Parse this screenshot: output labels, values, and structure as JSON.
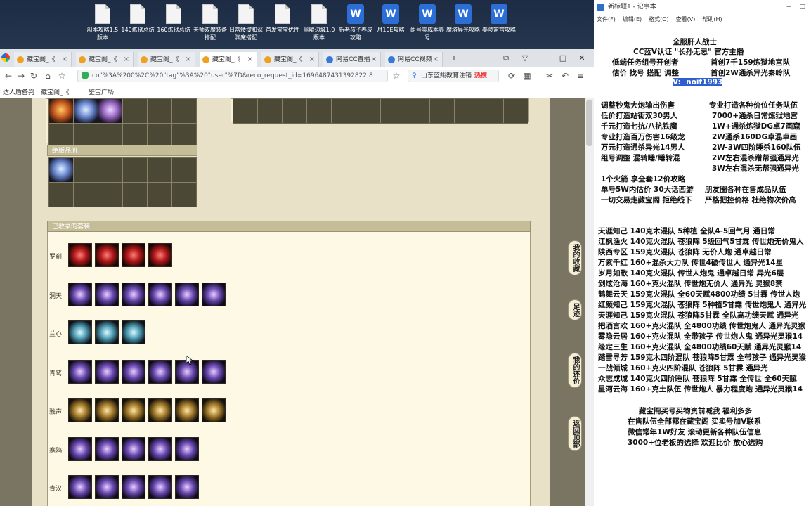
{
  "desktop": {
    "icons": [
      {
        "label": "副本攻略1.5版本",
        "type": "doc"
      },
      {
        "label": "140炼狱总结",
        "type": "doc"
      },
      {
        "label": "160炼狱总结",
        "type": "doc"
      },
      {
        "label": "天师双魔装备搭配",
        "type": "doc"
      },
      {
        "label": "日常矮拔和深渊魔搭配",
        "type": "doc"
      },
      {
        "label": "首发宝宝优性",
        "type": "doc"
      },
      {
        "label": "黑曜边城1.0版本",
        "type": "doc"
      },
      {
        "label": "新老孩子养成攻略",
        "type": "word"
      },
      {
        "label": "月10E攻略",
        "type": "word"
      },
      {
        "label": "组号零成本养号",
        "type": "word"
      },
      {
        "label": "魔塔异光攻略",
        "type": "word"
      },
      {
        "label": "秦陵宙宫攻略",
        "type": "word"
      }
    ]
  },
  "browser": {
    "tabs": [
      {
        "label": "藏宝阁_《",
        "active": false,
        "icon": "cbg"
      },
      {
        "label": "藏宝阁_《",
        "active": false,
        "icon": "cbg"
      },
      {
        "label": "藏宝阁_《",
        "active": false,
        "icon": "cbg"
      },
      {
        "label": "藏宝阁_《",
        "active": true,
        "icon": "cbg"
      },
      {
        "label": "藏宝阁_《",
        "active": false,
        "icon": "cbg"
      },
      {
        "label": "网易CC直播",
        "active": false,
        "icon": "cc"
      },
      {
        "label": "网易CC视频",
        "active": false,
        "icon": "cc"
      }
    ],
    "tab_close": "×",
    "new_tab": "+",
    "window_controls": [
      "⧉",
      "▽",
      "−",
      "□",
      "✕"
    ],
    "url": "co\"%3A%200%2C%20\"tag\"%3A%20\"user\"%7D&reco_request_id=1696487431392822|8",
    "search_text": "山东蓝翔教育注销",
    "search_hot": "热搜",
    "bookmarks": [
      "达人盾备判",
      "藏宝阁_《",
      "鉴宝广场"
    ]
  },
  "game_page": {
    "section_upper_title": "绝版品册",
    "section_sets_title": "已收录的套装",
    "sets": [
      {
        "name": "罗刹:",
        "count": 4,
        "style": "red"
      },
      {
        "name": "洞天:",
        "count": 6,
        "style": "violet"
      },
      {
        "name": "兰心:",
        "count": 3,
        "style": "cyan"
      },
      {
        "name": "青鸾:",
        "count": 6,
        "style": "violet"
      },
      {
        "name": "雅声:",
        "count": 6,
        "style": "gold"
      },
      {
        "name": "寒鸦:",
        "count": 5,
        "style": "violet"
      },
      {
        "name": "青汉:",
        "count": 5,
        "style": "violet"
      }
    ],
    "side_tabs": [
      "我的收藏",
      "足迹",
      "我的还价",
      "返回顶部"
    ]
  },
  "notepad": {
    "title": "新标题1 - 记事本",
    "menu": [
      "文件(F)",
      "编辑(E)",
      "格式(O)",
      "查看(V)",
      "帮助(H)"
    ],
    "header_lines": [
      "全服肝人战士",
      "CC蓝V认证 \"长孙无忌\" 官方主播",
      "低端任务组号开创者",
      "估价 找号 搭配 调整"
    ],
    "header_right": [
      "首创7千159炼狱地宫队",
      "首创2W通杀异光秦岭队"
    ],
    "vx_line": "V:  noif1993",
    "left_col": [
      "调整秒鬼大炮输出伤害",
      "低价打造站街双30男人",
      "千元打造七抗/八抗铁魔",
      "专业打造百万伤害16级龙",
      "万元打造通杀异光14男人",
      "组号调整 混转睡/睡转混"
    ],
    "right_col": [
      "专业打造各种价位任务队伍",
      "7000+通杀日常炼狱地宫",
      "1W+通杀炼狱DG卓7画窟",
      "2W通杀160DG卓混卓画",
      "2W-3W四阶睡杀160队伍",
      "2W左右混杀蹭帮强通异光",
      "3W左右混杀无帮强通异光"
    ],
    "mid_lines": [
      "1个火箭 享全套12价攻略",
      "单号5W内估价 30大话西游",
      "一切交易走藏宝阁 拒绝线下"
    ],
    "mid_right": [
      "朋友圈各种在售成品队伍",
      "严格把控价格 杜绝物次价高"
    ],
    "list": [
      "天涯知己 140克木混队 5种植 全队4-5回气月 通日常",
      "江枫渔火 140克火混队 苍狼阵 5级回气5甘霖 传世炮无价鬼人",
      "陕西专区 159克火混队 苍狼阵 无价人炮 通卓越日常",
      "万紫千红 160+混杀大力队 传世4破传世人 通异光14星",
      "岁月如歌 140克火混队 传世人炮鬼 通卓越日常 异光6层",
      "剑炫沧海 160+克火混队 传世炮无价人 通异光 灵猴8禁",
      "鹤舞云天 159克火混队 全60天赋4800功绩 5甘霖 传世人炮",
      "红颜知己 159克火混队 苍狼阵 5种植5甘霖 传世炮鬼人 通异光",
      "天涯知己 159克火混队 苍狼阵5甘霖 全队高功绩天赋 通异光",
      "把酒言欢 160+克火混队 全4800功绩 传世炮鬼人 通异光灵猴",
      "雾隐云居 160+克火混队 全带孩子 传世炮人鬼 通异光灵猴14",
      "缘定三生 160+克火混队 全4800功绩60天赋 通异光灵猴14",
      "踏雪寻芳 159克木四阶混队 苍狼阵5甘霖 全带孩子 通异光灵猴",
      "一战倾城 160+克火四阶混队 苍狼阵 5甘霖 通异光",
      "众志成城 140克火四阶睡队 苍狼阵 5甘霖 全传世 全60天赋",
      "星河云海 160+克土队伍 传世炮人 暴力程度炮 通异光灵猴14"
    ],
    "footer": [
      "藏宝阁买号买物资前喊我 福利多多",
      "在售队伍全部都在藏宝阁 买卖号加V联系",
      "微信常年1W好友 滚动更新各种队伍信息",
      "3000+位老板的选择 欢迎比价 放心选购"
    ]
  }
}
